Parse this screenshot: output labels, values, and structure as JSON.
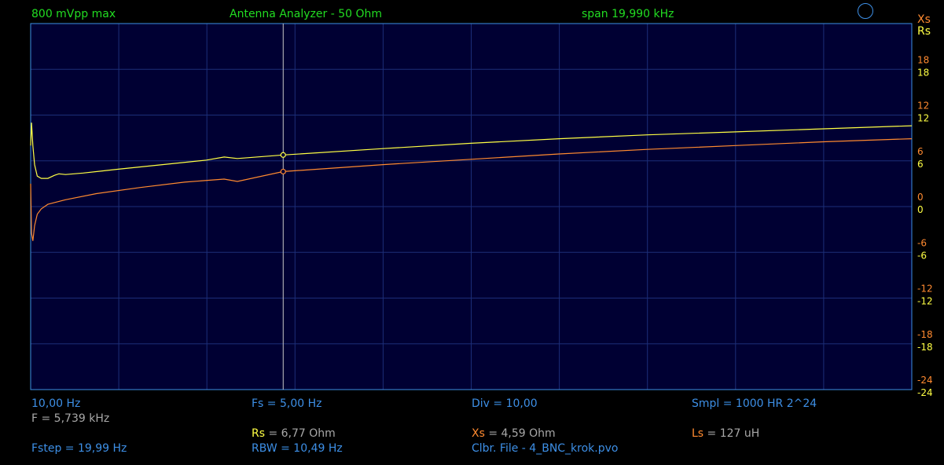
{
  "header": {
    "amplitude": "800 mVpp max",
    "title": "Antenna Analyzer - 50 Ohm",
    "span": "span 19,990 kHz"
  },
  "legend": {
    "xs": "Xs",
    "rs": "Rs"
  },
  "footer": {
    "f_start": "10,00 Hz",
    "fs": "Fs = 5,00 Hz",
    "div": "Div = 10,00",
    "smpl": "Smpl = 1000 HR  2^24",
    "f_cursor": "F = 5,739 kHz",
    "rs_label": "Rs",
    "rs_value": " = 6,77 Ohm",
    "xs_label": "Xs",
    "xs_value": " = 4,59 Ohm",
    "ls_label": "Ls",
    "ls_value": " = 127 uH",
    "fstep": "Fstep = 19,99 Hz",
    "rbw": "RBW = 10,49 Hz",
    "calib": "Clbr. File - 4_BNC_krok.pvo"
  },
  "colors": {
    "background": "#000000",
    "plot_bg": "#000033",
    "grid": "#1c2e78",
    "frame": "#3d8fe6",
    "rs": "#ffff44",
    "xs": "#ff8a30",
    "cursor": "#c8c8c8"
  },
  "chart_data": {
    "type": "line",
    "title": "Antenna Analyzer - 50 Ohm",
    "xlim": [
      10,
      20000
    ],
    "ylim": [
      -24,
      24
    ],
    "grid": true,
    "x_divisions": 10,
    "cursor_x": 5739,
    "right_ticks_xs": [
      "18",
      "12",
      "6",
      "0",
      "-6",
      "-12",
      "-18",
      "-24"
    ],
    "right_ticks_rs": [
      "18",
      "12",
      "6",
      "0",
      "-6",
      "-12",
      "-18",
      "-24"
    ],
    "series": [
      {
        "name": "Rs",
        "color": "#ffff44",
        "points": [
          [
            10,
            8.0
          ],
          [
            30,
            11.0
          ],
          [
            60,
            8.0
          ],
          [
            100,
            5.5
          ],
          [
            160,
            4.0
          ],
          [
            250,
            3.7
          ],
          [
            400,
            3.7
          ],
          [
            550,
            4.1
          ],
          [
            650,
            4.3
          ],
          [
            800,
            4.2
          ],
          [
            1200,
            4.4
          ],
          [
            2000,
            4.9
          ],
          [
            3000,
            5.5
          ],
          [
            4000,
            6.1
          ],
          [
            4400,
            6.5
          ],
          [
            4700,
            6.3
          ],
          [
            5739,
            6.77
          ],
          [
            8000,
            7.6
          ],
          [
            10000,
            8.3
          ],
          [
            12000,
            8.9
          ],
          [
            14000,
            9.4
          ],
          [
            16000,
            9.8
          ],
          [
            18000,
            10.2
          ],
          [
            20000,
            10.6
          ]
        ]
      },
      {
        "name": "Xs",
        "color": "#ff8a30",
        "points": [
          [
            10,
            3.0
          ],
          [
            30,
            -3.5
          ],
          [
            60,
            -4.5
          ],
          [
            100,
            -2.5
          ],
          [
            160,
            -1.0
          ],
          [
            250,
            -0.3
          ],
          [
            400,
            0.3
          ],
          [
            600,
            0.6
          ],
          [
            800,
            0.9
          ],
          [
            1500,
            1.7
          ],
          [
            2500,
            2.5
          ],
          [
            3500,
            3.2
          ],
          [
            4400,
            3.6
          ],
          [
            4700,
            3.3
          ],
          [
            5739,
            4.59
          ],
          [
            8000,
            5.5
          ],
          [
            10000,
            6.2
          ],
          [
            12000,
            6.9
          ],
          [
            14000,
            7.5
          ],
          [
            16000,
            8.0
          ],
          [
            18000,
            8.5
          ],
          [
            20000,
            8.9
          ]
        ]
      }
    ]
  }
}
